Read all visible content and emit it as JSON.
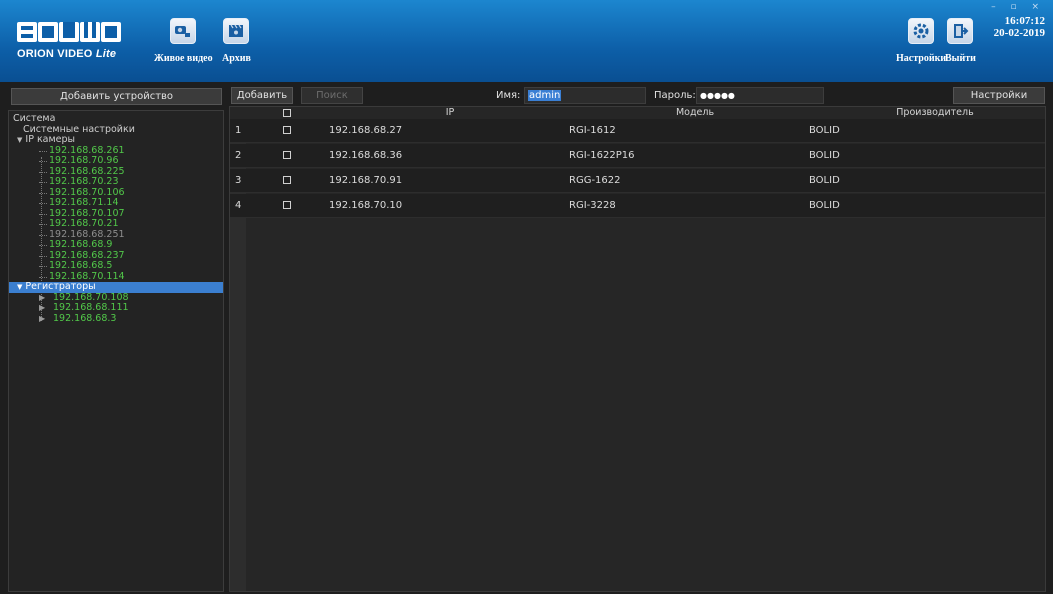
{
  "header": {
    "logo_text": "BOLID",
    "logo_sub": "ORION VIDEO",
    "logo_sub_italic": "Lite",
    "nav": [
      {
        "label": "Живое видео",
        "icon": "camera-icon"
      },
      {
        "label": "Архив",
        "icon": "film-icon"
      }
    ],
    "settings_label": "Настройки",
    "exit_label": "Выйти",
    "time": "16:07:12",
    "date": "20-02-2019"
  },
  "left": {
    "add_device": "Добавить устройство",
    "tree": {
      "root": "Система",
      "system_settings": "Системные настройки",
      "ip_cameras": "IP камеры",
      "cameras": [
        {
          "ip": "192.168.68.261",
          "online": true
        },
        {
          "ip": "192.168.70.96",
          "online": true
        },
        {
          "ip": "192.168.68.225",
          "online": true
        },
        {
          "ip": "192.168.70.23",
          "online": true
        },
        {
          "ip": "192.168.70.106",
          "online": true
        },
        {
          "ip": "192.168.71.14",
          "online": true
        },
        {
          "ip": "192.168.70.107",
          "online": true
        },
        {
          "ip": "192.168.70.21",
          "online": true
        },
        {
          "ip": "192.168.68.251",
          "online": false
        },
        {
          "ip": "192.168.68.9",
          "online": true
        },
        {
          "ip": "192.168.68.237",
          "online": true
        },
        {
          "ip": "192.168.68.5",
          "online": true
        },
        {
          "ip": "192.168.70.114",
          "online": true
        }
      ],
      "recorders": "Регистраторы",
      "recorder_items": [
        "192.168.70.108",
        "192.168.68.111",
        "192.168.68.3"
      ]
    }
  },
  "toolbar": {
    "add": "Добавить",
    "search": "Поиск",
    "name_label": "Имя:",
    "name_value": "admin",
    "password_label": "Пароль:",
    "password_value": "●●●●●",
    "search_settings": "Настройки поиска"
  },
  "table": {
    "columns": [
      "",
      "IP",
      "Модель",
      "Производитель"
    ],
    "rows": [
      {
        "num": "1",
        "ip": "192.168.68.27",
        "model": "RGI-1612",
        "vendor": "BOLID"
      },
      {
        "num": "2",
        "ip": "192.168.68.36",
        "model": "RGI-1622P16",
        "vendor": "BOLID"
      },
      {
        "num": "3",
        "ip": "192.168.70.91",
        "model": "RGG-1622",
        "vendor": "BOLID"
      },
      {
        "num": "4",
        "ip": "192.168.70.10",
        "model": "RGI-3228",
        "vendor": "BOLID"
      }
    ]
  },
  "colors": {
    "header_blue": "#0d5fa8",
    "selected": "#3b7fd0",
    "online": "#52c84a",
    "offline": "#8e8e8e"
  }
}
